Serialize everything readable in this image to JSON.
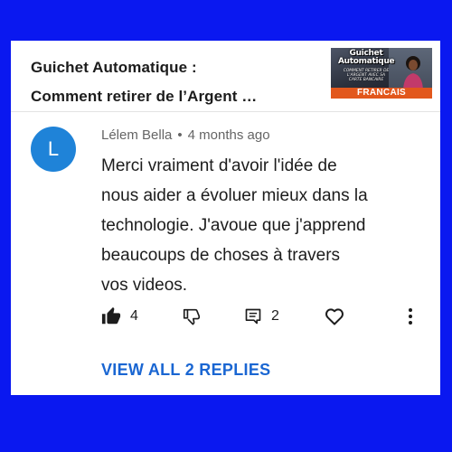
{
  "video": {
    "title_lines": [
      "Guichet Automatique :",
      "Comment retirer de l’Argent …"
    ],
    "thumbnail": {
      "title_line1": "Guichet",
      "title_line2": "Automatique",
      "subtitle_lines": [
        "COMMENT RETIRER DE",
        "L'ARGENT AVEC SA",
        "CARTE BANCAIRE"
      ],
      "language_label": "FRANCAIS"
    }
  },
  "comment": {
    "avatar_letter": "L",
    "author": "Lélem Bella",
    "separator": "•",
    "time": "4 months ago",
    "text_lines": [
      "Merci vraiment d'avoir l'idée de",
      "nous aider a évoluer mieux dans la",
      "technologie. J'avoue que j'apprend",
      "beaucoups de choses à travers",
      "vos videos."
    ]
  },
  "actions": {
    "like_count": "4",
    "reply_count": "2",
    "like_icon": "thumb-up-icon",
    "dislike_icon": "thumb-down-icon",
    "reply_icon": "comment-icon",
    "heart_icon": "heart-icon",
    "more_icon": "more-vertical-icon"
  },
  "view_replies_label": "VIEW ALL 2 REPLIES",
  "colors": {
    "frame": "#0a18f0",
    "avatar": "#1f83d8",
    "link": "#1a66d2",
    "thumbnail_banner": "#e2571c"
  }
}
